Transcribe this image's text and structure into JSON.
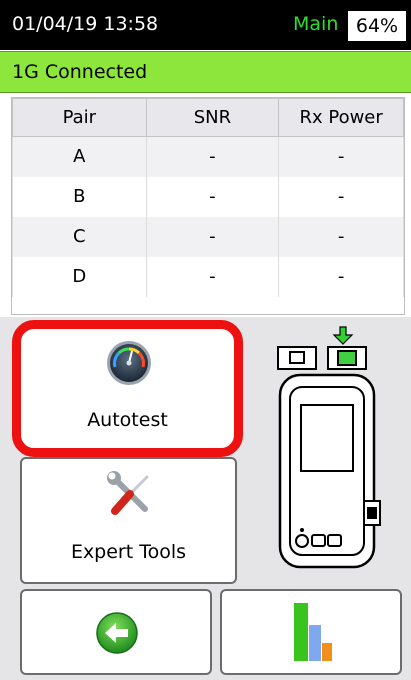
{
  "status": {
    "datetime": "01/04/19 13:58",
    "mode": "Main",
    "battery": "64%"
  },
  "link": {
    "status": "1G Connected"
  },
  "table": {
    "headers": [
      "Pair",
      "SNR",
      "Rx Power"
    ],
    "rows": [
      [
        "A",
        "-",
        "-"
      ],
      [
        "B",
        "-",
        "-"
      ],
      [
        "C",
        "-",
        "-"
      ],
      [
        "D",
        "-",
        "-"
      ]
    ]
  },
  "buttons": {
    "autotest": "Autotest",
    "expert": "Expert Tools"
  },
  "icons": {
    "autotest": "speedometer-gauge-icon",
    "expert": "wrench-screwdriver-icon",
    "back": "back-arrow-icon",
    "results": "bar-chart-icon",
    "device": "tester-device-icon"
  },
  "colors": {
    "link_bar": "#8de63c",
    "mode_text": "#2fdc2f",
    "highlight_border": "#ee1111"
  }
}
